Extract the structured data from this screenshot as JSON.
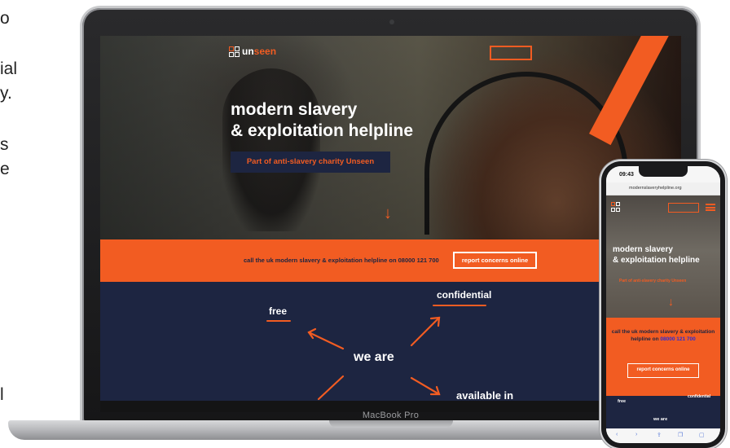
{
  "side_text": [
    "o",
    "ial",
    "y.",
    "s",
    "e",
    "l"
  ],
  "laptop": {
    "brand_label": "MacBook Pro",
    "site": {
      "logo": {
        "prefix": "un",
        "suffix": "seen"
      },
      "headline_line1": "modern slavery",
      "headline_line2": "& exploitation helpline",
      "tagline": "Part of anti-slavery charity Unseen",
      "arrow": "↓",
      "band": {
        "text": "call the uk modern slavery & exploitation helpline on 08000 121 700",
        "button": "report concerns online"
      },
      "we_are": {
        "center": "we are",
        "free": "free",
        "confidential": "confidential",
        "available": "available in"
      }
    }
  },
  "phone": {
    "time": "09:43",
    "url": "modernslaveryhelpline.org",
    "headline_line1": "modern slavery",
    "headline_line2": "& exploitation helpline",
    "tagline": "Part of anti-slavery charity Unseen",
    "arrow": "↓",
    "call_text": "call the uk modern slavery & exploitation helpline on ",
    "call_number": "08000 121 700",
    "report": "report concerns online",
    "free": "free",
    "confidential": "confidential",
    "we_are": "we are"
  },
  "colors": {
    "accent": "#f25c22",
    "navy": "#1d2541"
  }
}
